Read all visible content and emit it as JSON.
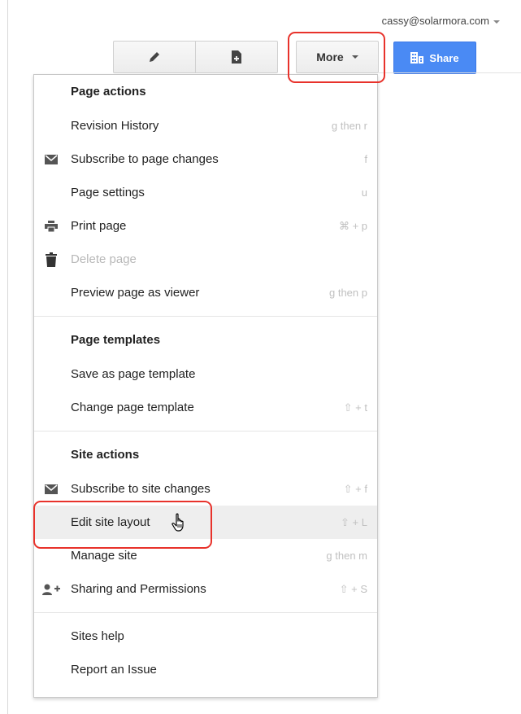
{
  "account": {
    "email": "cassy@solarmora.com"
  },
  "toolbar": {
    "more_label": "More",
    "share_label": "Share"
  },
  "menu": {
    "sections": [
      {
        "header": "Page actions",
        "items": [
          {
            "label": "Revision History",
            "shortcut": "g then r"
          },
          {
            "label": "Subscribe to page changes",
            "shortcut": "f",
            "icon": "envelope-icon"
          },
          {
            "label": "Page settings",
            "shortcut": "u"
          },
          {
            "label": "Print page",
            "shortcut": "⌘ + p",
            "icon": "printer-icon"
          },
          {
            "label": "Delete page",
            "shortcut": "",
            "icon": "trash-icon",
            "disabled": true
          },
          {
            "label": "Preview page as viewer",
            "shortcut": "g then p"
          }
        ]
      },
      {
        "header": "Page templates",
        "items": [
          {
            "label": "Save as page template",
            "shortcut": ""
          },
          {
            "label": "Change page template",
            "shortcut": "⇧ + t"
          }
        ]
      },
      {
        "header": "Site actions",
        "items": [
          {
            "label": "Subscribe to site changes",
            "shortcut": "⇧ + f",
            "icon": "envelope-icon"
          },
          {
            "label": "Edit site layout",
            "shortcut": "⇧ + L",
            "hovered": true
          },
          {
            "label": "Manage site",
            "shortcut": "g then m"
          },
          {
            "label": "Sharing and Permissions",
            "shortcut": "⇧ + S",
            "icon": "add-person-icon"
          }
        ]
      },
      {
        "header": "",
        "items": [
          {
            "label": "Sites help",
            "shortcut": ""
          },
          {
            "label": "Report an Issue",
            "shortcut": ""
          }
        ]
      }
    ]
  },
  "colors": {
    "share_button": "#4a8af4",
    "highlight_ring": "#e8322b",
    "hover_row": "#eeeeee"
  }
}
